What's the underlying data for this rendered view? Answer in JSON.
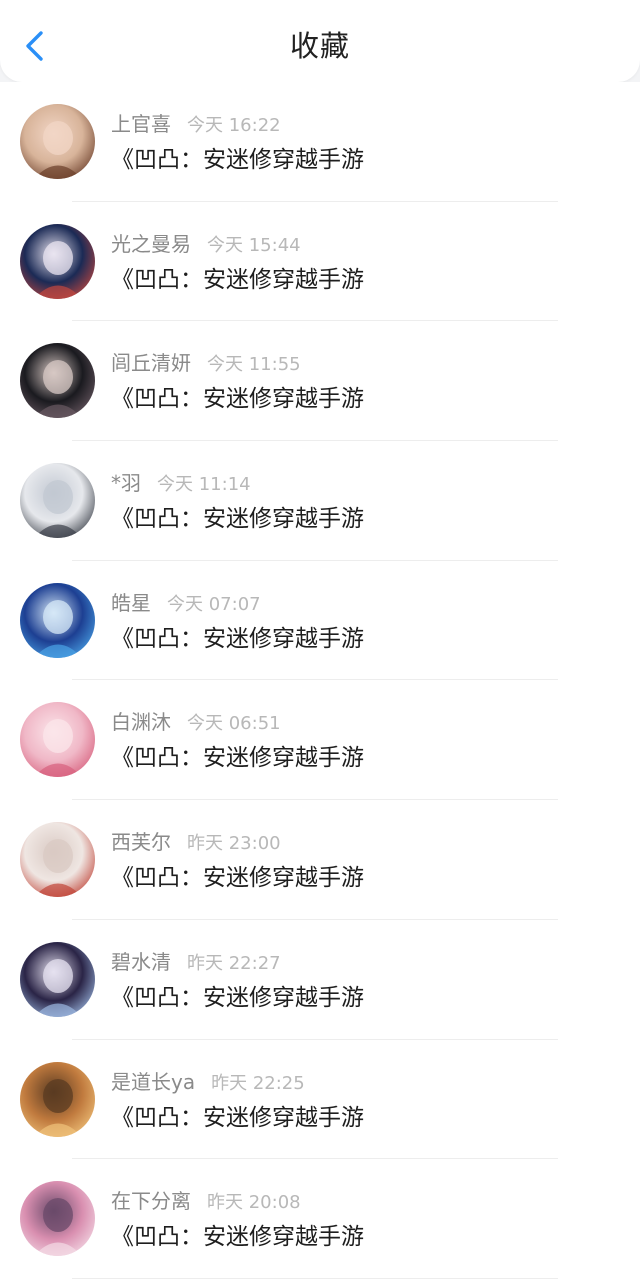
{
  "header": {
    "title": "收藏",
    "back_icon": "chevron-left-icon",
    "accent_color": "#2a8ff7"
  },
  "items": [
    {
      "user": "上官喜",
      "time": "今天 16:22",
      "text": "《凹凸：安迷修穿越手游",
      "avatar_colors": [
        "#d8b49a",
        "#6b3e2a",
        "#f2d6c6"
      ]
    },
    {
      "user": "光之曼易",
      "time": "今天 15:44",
      "text": "《凹凸：安迷修穿越手游",
      "avatar_colors": [
        "#1b2a55",
        "#c3473f",
        "#e9e4f0"
      ]
    },
    {
      "user": "闾丘清妍",
      "time": "今天 11:55",
      "text": "《凹凸：安迷修穿越手游",
      "avatar_colors": [
        "#1a1a1f",
        "#6a5a63",
        "#d7c8c4"
      ]
    },
    {
      "user": "*羽",
      "time": "今天 11:14",
      "text": "《凹凸：安迷修穿越手游",
      "avatar_colors": [
        "#e6e8ec",
        "#3a3f48",
        "#c2c8d2"
      ]
    },
    {
      "user": "皓星",
      "time": "今天 07:07",
      "text": "《凹凸：安迷修穿越手游",
      "avatar_colors": [
        "#1d3f92",
        "#4aa3e6",
        "#d6e8f7"
      ]
    },
    {
      "user": "白渊沐",
      "time": "今天 06:51",
      "text": "《凹凸：安迷修穿越手游",
      "avatar_colors": [
        "#f0b8c7",
        "#d7607d",
        "#fbe5ea"
      ]
    },
    {
      "user": "西芙尔",
      "time": "昨天 23:00",
      "text": "《凹凸：安迷修穿越手游",
      "avatar_colors": [
        "#efe6e2",
        "#c04438",
        "#d9c9c3"
      ]
    },
    {
      "user": "碧水清",
      "time": "昨天 22:27",
      "text": "《凹凸：安迷修穿越手游",
      "avatar_colors": [
        "#2a2446",
        "#9bb7e0",
        "#e5e1f0"
      ]
    },
    {
      "user": "是道长ya",
      "time": "昨天 22:25",
      "text": "《凹凸：安迷修穿越手游",
      "avatar_colors": [
        "#c07a3e",
        "#f0c27a",
        "#5a3b22"
      ]
    },
    {
      "user": "在下分离",
      "time": "昨天 20:08",
      "text": "《凹凸：安迷修穿越手游",
      "avatar_colors": [
        "#d98fb0",
        "#f4dbe6",
        "#6a4a6a"
      ]
    }
  ]
}
